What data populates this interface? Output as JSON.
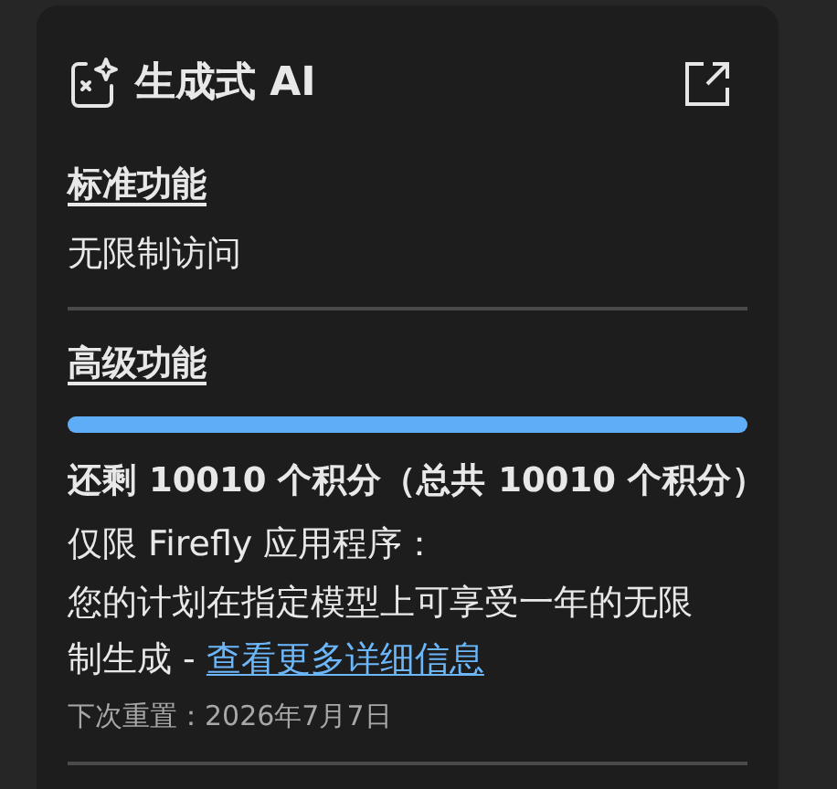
{
  "header": {
    "title": "生成式 AI"
  },
  "sections": [
    {
      "heading": "标准功能",
      "kind": "plain",
      "text": "无限制访问"
    },
    {
      "heading": "高级功能",
      "kind": "credits",
      "level": 1,
      "credits": "还剩 10010 个积分（总共 10010 个积分）",
      "scope": "仅限 Firefly 应用程序：",
      "description": "您的计划在指定模型上可享受一年的无限制生成 - ",
      "link": "查看更多详细信息",
      "reset": "下次重置：2026年7月7日"
    }
  ]
}
